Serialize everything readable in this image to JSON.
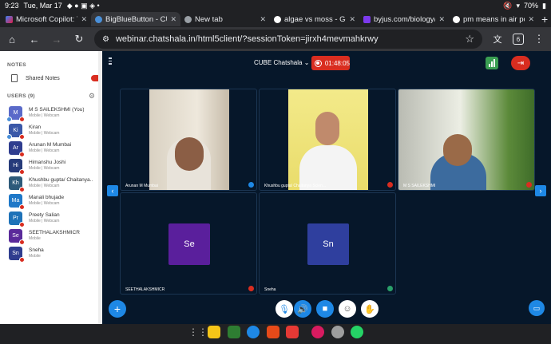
{
  "status_bar": {
    "time": "9:23",
    "date": "Tue, Mar 17",
    "battery": "70%"
  },
  "tabs": [
    {
      "title": "Microsoft Copilot: Y",
      "color": "#3b82f6"
    },
    {
      "title": "BigBlueButton - CU",
      "color": "#4a90d9"
    },
    {
      "title": "New tab",
      "color": "#9aa0a6"
    },
    {
      "title": "algae vs moss - Goo",
      "color": "#ffffff"
    },
    {
      "title": "byjus.com/biology/d",
      "color": "#7c3aed"
    },
    {
      "title": "pm means in air poll",
      "color": "#ffffff"
    }
  ],
  "address_bar": {
    "url": "webinar.chatshala.in/html5client/?sessionToken=jirxh4mevmahkrwy",
    "tab_count": "6"
  },
  "sidebar": {
    "notes_header": "NOTES",
    "shared_notes": "Shared Notes",
    "users_header": "USERS (9)",
    "users": [
      {
        "initials": "M",
        "name": "M S SAILEKSHMI (You)",
        "sub": "Mobile | Webcam",
        "color": "#5a6ac9"
      },
      {
        "initials": "Ki",
        "name": "Kiran",
        "sub": "Mobile | Webcam",
        "color": "#3a58a8"
      },
      {
        "initials": "Ar",
        "name": "Arunan M Mumbai",
        "sub": "Mobile | Webcam",
        "color": "#2f3d8f"
      },
      {
        "initials": "Hi",
        "name": "Himanshu Joshi",
        "sub": "Mobile | Webcam",
        "color": "#263b7a"
      },
      {
        "initials": "Kh",
        "name": "Khushbu gupta/ Chaitanya...",
        "sub": "Mobile | Webcam",
        "color": "#2d5a7a"
      },
      {
        "initials": "Ma",
        "name": "Manali bhujade",
        "sub": "Mobile | Webcam",
        "color": "#1e78c8"
      },
      {
        "initials": "Pr",
        "name": "Preety Salian",
        "sub": "Mobile | Webcam",
        "color": "#1e72b8"
      },
      {
        "initials": "Se",
        "name": "SEETHALAKSHMICR",
        "sub": "Mobile",
        "color": "#5a2a9a"
      },
      {
        "initials": "Sn",
        "name": "Sneha",
        "sub": "Mobile",
        "color": "#2f3d8f"
      }
    ]
  },
  "meeting": {
    "name": "CUBE Chatshala",
    "timer": "01:48:05"
  },
  "tiles": [
    {
      "label": "Arunan M Mumbai"
    },
    {
      "label": "Khushbu gupta/ Chaitanya Scien..."
    },
    {
      "label": "M S SAILEKSHMI"
    },
    {
      "label": "SEETHALAKSHMICR",
      "initials": "Se",
      "color": "#5a1f9c"
    },
    {
      "label": "Sneha",
      "initials": "Sn",
      "color": "#2f3f9e"
    }
  ]
}
